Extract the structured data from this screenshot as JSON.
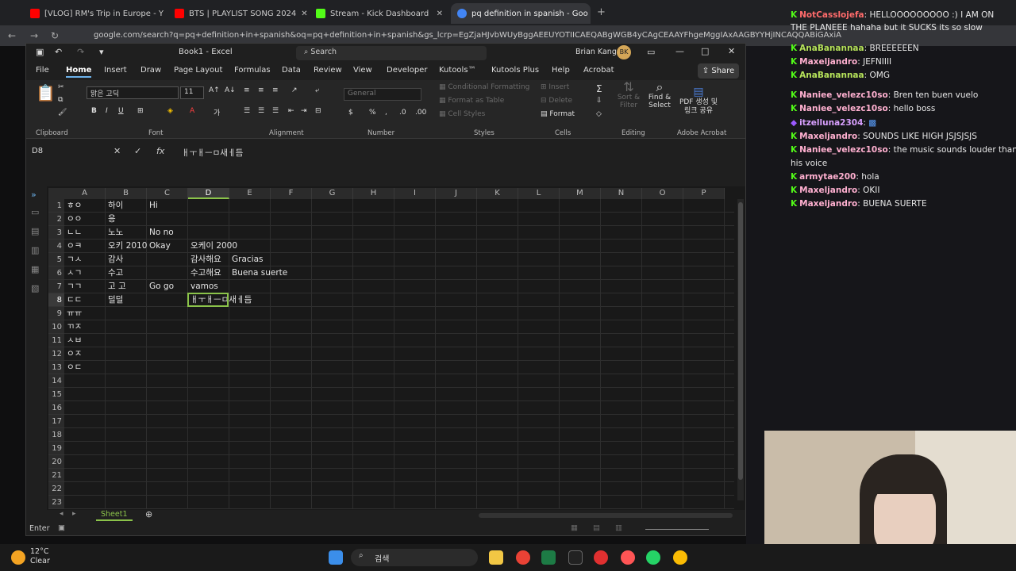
{
  "browser": {
    "tabs": [
      {
        "title": "[VLOG] RM's Trip in Europe - Y",
        "color": "#ff0000"
      },
      {
        "title": "BTS | PLAYLIST SONG 2024",
        "color": "#ff0000"
      },
      {
        "title": "Stream - Kick Dashboard",
        "color": "#53fc18"
      },
      {
        "title": "pq definition in spanish - Goo",
        "color": "#4285f4"
      }
    ],
    "url": "google.com/search?q=pq+definition+in+spanish&oq=pq+definition+in+spanish&gs_lcrp=EgZjaHJvbWUyBggAEEUYOTIICAEQABgWGB4yCAgCEAAYFhgeMggIAxAAGBYYHjINCAQQABiGAxiABBiKBTIN"
  },
  "excel": {
    "title": "Book1 - Excel",
    "search_placeholder": "Search",
    "user": "Brian Kang",
    "user_initials": "BK",
    "ribbon_tabs": [
      "File",
      "Home",
      "Insert",
      "Draw",
      "Page Layout",
      "Formulas",
      "Data",
      "Review",
      "View",
      "Developer",
      "Kutools™",
      "Kutools Plus",
      "Help",
      "Acrobat"
    ],
    "share": "Share",
    "font_name": "맑은 고딕",
    "font_size": "11",
    "number_format": "General",
    "groups": {
      "clipboard": "Clipboard",
      "font": "Font",
      "alignment": "Alignment",
      "number": "Number",
      "styles": "Styles",
      "cells": "Cells",
      "editing": "Editing",
      "adobe": "Adobe Acrobat"
    },
    "styles_items": [
      "Conditional Formatting",
      "Format as Table",
      "Cell Styles"
    ],
    "cells_items": [
      "Insert",
      "Delete",
      "Format"
    ],
    "editing_items": [
      "Sort & Filter",
      "Find & Select"
    ],
    "adobe_item": "PDF 생성 및 링크 공유",
    "name_box": "D8",
    "formula": "ㅐㅜㅐㅡㅁ새ㅔ듬",
    "columns": [
      "A",
      "B",
      "C",
      "D",
      "E",
      "F",
      "G",
      "H",
      "I",
      "J",
      "K",
      "L",
      "M",
      "N",
      "O",
      "P"
    ],
    "rows": [
      "1",
      "2",
      "3",
      "4",
      "5",
      "6",
      "7",
      "8",
      "9",
      "10",
      "11",
      "12",
      "13",
      "14",
      "15",
      "16",
      "17",
      "18",
      "19",
      "20",
      "21",
      "22",
      "23"
    ],
    "cells": [
      {
        "ref": "A1",
        "v": "ㅎㅇ"
      },
      {
        "ref": "B1",
        "v": "하이"
      },
      {
        "ref": "C1",
        "v": "Hi"
      },
      {
        "ref": "A2",
        "v": "ㅇㅇ"
      },
      {
        "ref": "B2",
        "v": "응"
      },
      {
        "ref": "A3",
        "v": "ㄴㄴ"
      },
      {
        "ref": "B3",
        "v": "노노"
      },
      {
        "ref": "C3",
        "v": "No no"
      },
      {
        "ref": "A4",
        "v": "ㅇㅋ"
      },
      {
        "ref": "B4",
        "v": "오키 2010"
      },
      {
        "ref": "C4",
        "v": "Okay"
      },
      {
        "ref": "D4",
        "v": "오케이 2000"
      },
      {
        "ref": "A5",
        "v": "ㄱㅅ"
      },
      {
        "ref": "B5",
        "v": "감사"
      },
      {
        "ref": "D5",
        "v": "감사해요"
      },
      {
        "ref": "E5",
        "v": "Gracias"
      },
      {
        "ref": "A6",
        "v": "ㅅㄱ"
      },
      {
        "ref": "B6",
        "v": "수고"
      },
      {
        "ref": "D6",
        "v": "수고해요"
      },
      {
        "ref": "E6",
        "v": "Buena suerte"
      },
      {
        "ref": "A7",
        "v": "ㄱㄱ"
      },
      {
        "ref": "B7",
        "v": "고 고"
      },
      {
        "ref": "C7",
        "v": "Go go"
      },
      {
        "ref": "D7",
        "v": "vamos"
      },
      {
        "ref": "A8",
        "v": "ㄷㄷ"
      },
      {
        "ref": "B8",
        "v": "덜덜"
      },
      {
        "ref": "D8",
        "v": "ㅐㅜㅐㅡㅁ새ㅔ듬"
      },
      {
        "ref": "A9",
        "v": "ㅠㅠ"
      },
      {
        "ref": "A10",
        "v": "ㄲㅈ"
      },
      {
        "ref": "A11",
        "v": "ㅅㅂ"
      },
      {
        "ref": "A12",
        "v": "ㅇㅈ"
      },
      {
        "ref": "A13",
        "v": "ㅇㄷ"
      }
    ],
    "sheet_tab": "Sheet1",
    "status": "Enter"
  },
  "chat": [
    {
      "user": "NotCasslojefa",
      "text": "HELLOOOOOOOOO :) I AM ON",
      "color": "#ff6b6b"
    },
    {
      "user": "",
      "text": "THE PLANEEE hahaha but it SUCKS its so slow",
      "color": ""
    },
    {
      "user": "AnaBanannaa",
      "text": "BREEEEEEN",
      "color": "#b6e35a"
    },
    {
      "user": "Maxeljandro",
      "text": "JEFNIIII",
      "color": "#ffb0d0"
    },
    {
      "user": "AnaBanannaa",
      "text": "OMG",
      "color": "#b6e35a"
    },
    {
      "user": "Naniee_velezc10so",
      "text": "Bren ten buen vuelo",
      "color": "#ffb0d0"
    },
    {
      "user": "Naniee_velezc10so",
      "text": "hello boss",
      "color": "#ffb0d0"
    },
    {
      "user": "itzelluna2304",
      "text": "",
      "color": "#d9a0ff"
    },
    {
      "user": "Maxeljandro",
      "text": "SOUNDS LIKE HIGH JSJSJSJS",
      "color": "#ffb0d0"
    },
    {
      "user": "Naniee_velezc10so",
      "text": "the music sounds louder than",
      "color": "#ffb0d0"
    },
    {
      "user": "",
      "text": "his voice",
      "color": ""
    },
    {
      "user": "armytae200",
      "text": "hola",
      "color": "#ffb0d0"
    },
    {
      "user": "Maxeljandro",
      "text": "OKII",
      "color": "#ffb0d0"
    },
    {
      "user": "Maxeljandro",
      "text": "BUENA SUERTE",
      "color": "#ffb0d0"
    }
  ],
  "taskbar": {
    "temp": "12°C",
    "weather": "Clear",
    "search": "검색"
  }
}
